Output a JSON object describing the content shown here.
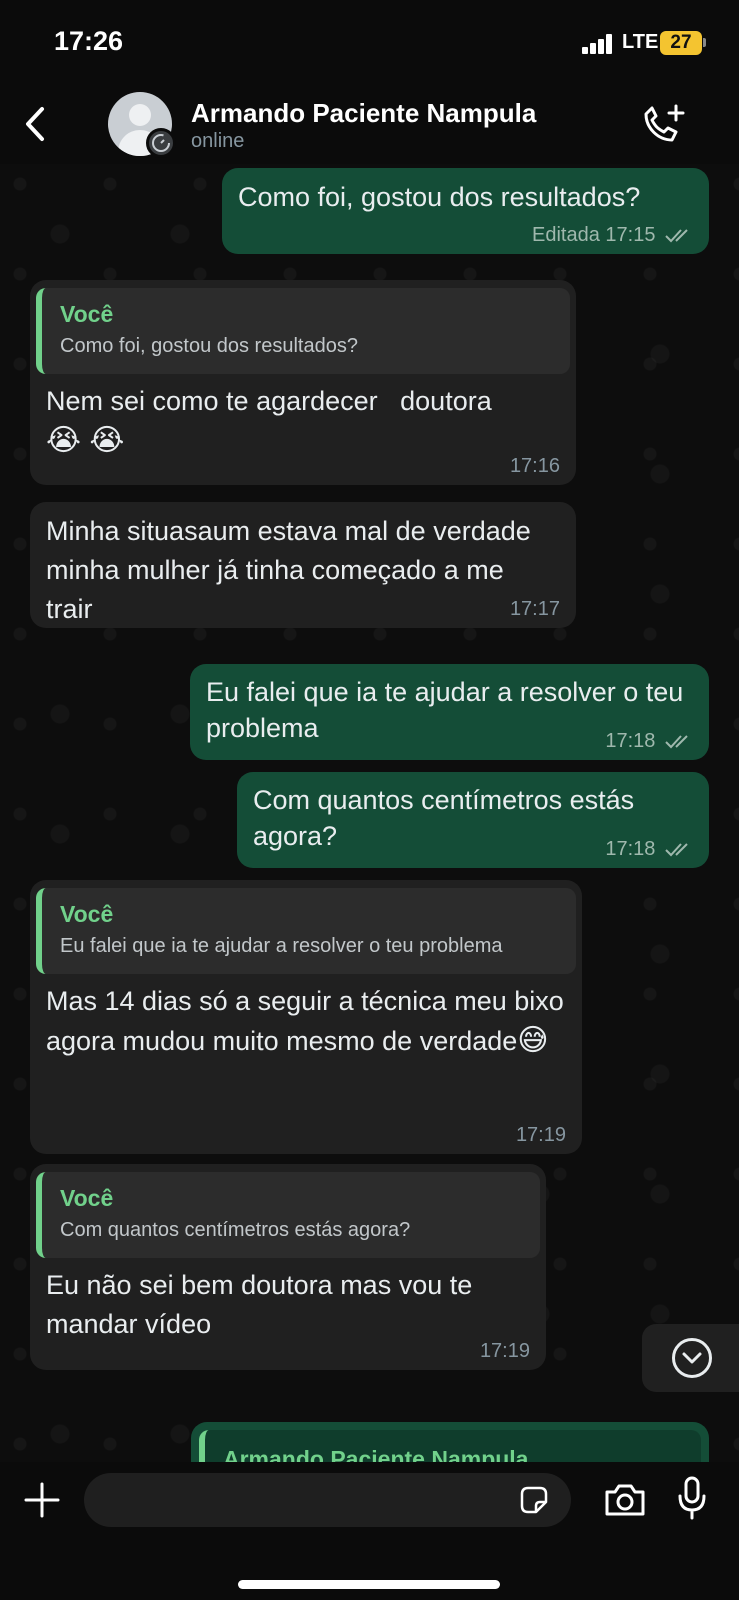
{
  "status_bar": {
    "time": "17:26",
    "network": "LTE",
    "battery": "27"
  },
  "header": {
    "contact_name": "Armando Paciente Nampula",
    "contact_status": "online"
  },
  "messages": [
    {
      "dir": "out",
      "text": "Como foi, gostou dos resultados?",
      "time": "Editada 17:15",
      "read": true
    },
    {
      "dir": "in",
      "quote_author": "Você",
      "quote_text": "Como foi, gostou dos resultados?",
      "text": "Nem sei como te agardecer   doutora",
      "emojis": "😭 😭",
      "time": "17:16"
    },
    {
      "dir": "in",
      "text": "Minha situasaum estava mal de verdade minha mulher já tinha começado a me trair",
      "time": "17:17"
    },
    {
      "dir": "out",
      "text": "Eu falei que ia te ajudar a resolver o teu problema",
      "time": "17:18",
      "read": true
    },
    {
      "dir": "out",
      "text": "Com quantos centímetros estás agora?",
      "time": "17:18",
      "read": true
    },
    {
      "dir": "in",
      "quote_author": "Você",
      "quote_text": "Eu falei que ia te ajudar a resolver o teu problema",
      "text": "Mas 14 dias só a seguir a técnica meu bixo agora mudou muito mesmo de verdade",
      "emojis": "😅",
      "time": "17:19"
    },
    {
      "dir": "in",
      "quote_author": "Você",
      "quote_text": "Com quantos centímetros estás agora?",
      "text": "Eu não sei bem doutora mas vou te mandar vídeo",
      "time": "17:19"
    }
  ],
  "partial_message": {
    "quote_author": "Armando Paciente Nampula"
  },
  "composer": {
    "placeholder": ""
  },
  "colors": {
    "outgoing_bubble": "#144d37",
    "incoming_bubble": "#202020",
    "quote_accent": "#71d18b",
    "ticks": "#9fb8ad"
  },
  "icons": [
    "chevron-left-icon",
    "timer-icon",
    "add-call-icon",
    "chevron-down-icon",
    "plus-icon",
    "sticker-icon",
    "camera-icon",
    "mic-icon",
    "double-check-icon"
  ]
}
